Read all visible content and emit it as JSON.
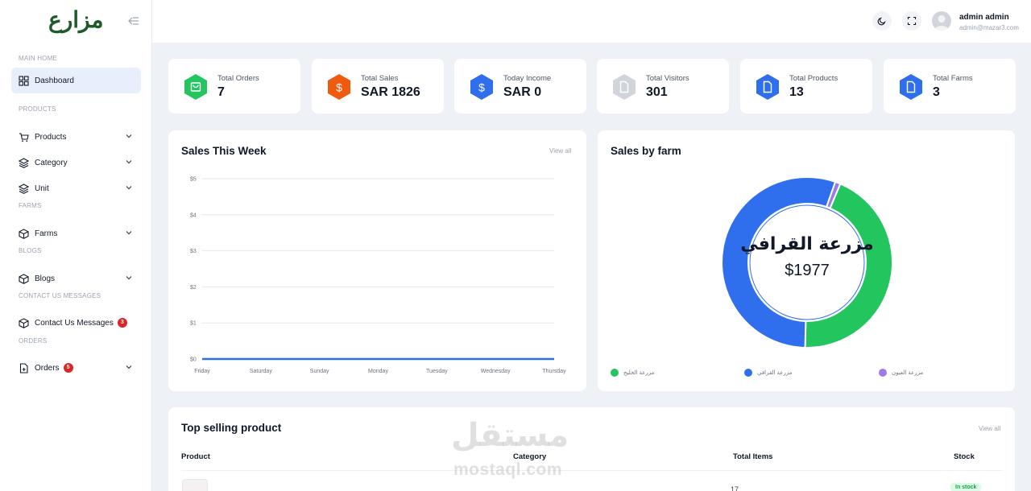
{
  "brand": {
    "logo_text": "مزارع"
  },
  "sidebar": {
    "sections": {
      "main_home": "MAIN HOME",
      "products": "PRODUCTS",
      "farms": "FARMS",
      "blogs": "BLOGS",
      "contact": "CONTACT US MESSAGES",
      "orders": "ORDERS"
    },
    "items": {
      "dashboard": "Dashboard",
      "products": "Products",
      "category": "Category",
      "unit": "Unit",
      "farms": "Farms",
      "blogs": "Blogs",
      "contact": "Contact Us Messages",
      "orders": "Orders"
    },
    "badges": {
      "contact": "3",
      "orders": "5"
    }
  },
  "header": {
    "user_name": "admin admin",
    "user_email": "admin@mazar3.com"
  },
  "stats": [
    {
      "label": "Total Orders",
      "value": "7",
      "color": "#22c55e",
      "icon": "shopping-bag-icon"
    },
    {
      "label": "Total Sales",
      "value": "SAR 1826",
      "color": "#f05a0e",
      "icon": "dollar-icon"
    },
    {
      "label": "Today Income",
      "value": "SAR 0",
      "color": "#2f6fed",
      "icon": "dollar-icon"
    },
    {
      "label": "Total Visitors",
      "value": "301",
      "color": "#d1d5db",
      "icon": "file-icon"
    },
    {
      "label": "Total Products",
      "value": "13",
      "color": "#2f6fed",
      "icon": "file-icon"
    },
    {
      "label": "Total Farms",
      "value": "3",
      "color": "#2f6fed",
      "icon": "file-icon"
    }
  ],
  "sales_week": {
    "title": "Sales This Week",
    "view_all": "View all"
  },
  "sales_farm": {
    "title": "Sales by farm",
    "center_label": "مزرعة القرافي",
    "center_value": "$1977",
    "legend": [
      {
        "name": "مزرعة الخليج",
        "color": "#22c55e"
      },
      {
        "name": "مزرعة القرافي",
        "color": "#2f6fed"
      },
      {
        "name": "مزرعة العيون",
        "color": "#9b7bea"
      }
    ]
  },
  "top_selling": {
    "title": "Top selling product",
    "view_all": "View all",
    "columns": [
      "Product",
      "Category",
      "Total Items",
      "Stock"
    ],
    "rows": [
      {
        "product": "...",
        "category": "...",
        "total_items": "17",
        "stock": "In stock"
      }
    ]
  },
  "watermark": {
    "arabic": "مستقل",
    "latin": "mostaql.com"
  },
  "chart_data": [
    {
      "type": "line",
      "title": "Sales This Week",
      "categories": [
        "Friday",
        "Saturday",
        "Sunday",
        "Monday",
        "Tuesday",
        "Wednesday",
        "Thursday"
      ],
      "series": [
        {
          "values": [
            0,
            0,
            0,
            0,
            0,
            0,
            0
          ],
          "color": "#2f6fed"
        }
      ],
      "y_ticks": [
        "$0",
        "$1",
        "$2",
        "$3",
        "$4",
        "$5"
      ],
      "ylim": [
        0,
        5
      ],
      "grid": true
    },
    {
      "type": "pie",
      "title": "Sales by farm",
      "donut": true,
      "categories": [
        "مزرعة الخليج",
        "مزرعة القرافي",
        "مزرعة العيون"
      ],
      "values": [
        44,
        55,
        1
      ],
      "colors": [
        "#22c55e",
        "#2f6fed",
        "#9b7bea"
      ]
    }
  ]
}
